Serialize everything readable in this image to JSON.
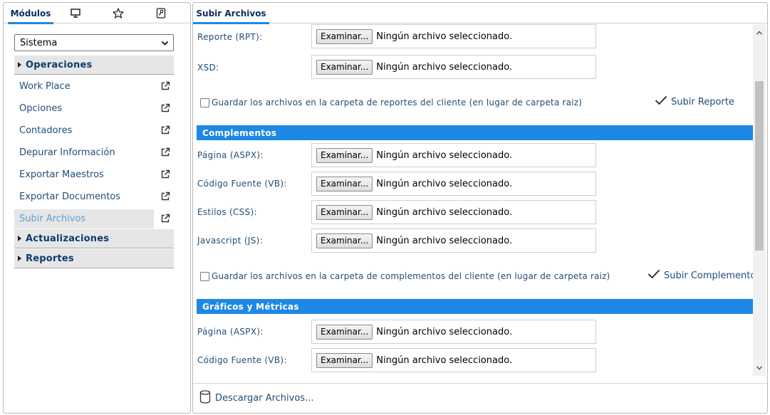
{
  "left": {
    "tabs": {
      "modules": "Módulos"
    },
    "select_value": "Sistema",
    "groups": {
      "operaciones": "Operaciones",
      "actualizaciones": "Actualizaciones",
      "reportes": "Reportes"
    },
    "items": [
      "Work Place",
      "Opciones",
      "Contadores",
      "Depurar Información",
      "Exportar Maestros",
      "Exportar Documentos",
      "Subir Archivos"
    ]
  },
  "right": {
    "tab": "Subir Archivos",
    "file_button": "Examinar...",
    "no_file": "Ningún archivo seleccionado.",
    "reporte": {
      "rpt_label": "Reporte (RPT):",
      "xsd_label": "XSD:",
      "checkbox_label": "Guardar los archivos en la carpeta de reportes del cliente (en lugar de carpeta raiz)",
      "submit": "Subir Reporte"
    },
    "complementos": {
      "title": "Complementos",
      "aspx_label": "Página (ASPX):",
      "vb_label": "Código Fuente (VB):",
      "css_label": "Estilos (CSS):",
      "js_label": "Javascript (JS):",
      "checkbox_label": "Guardar los archivos en la carpeta de complementos del cliente (en lugar de carpeta raiz)",
      "submit": "Subir Complemento"
    },
    "graficos": {
      "title": "Gráficos y Métricas",
      "aspx_label": "Página (ASPX):",
      "vb_label": "Código Fuente (VB):"
    },
    "download": "Descargar Archivos..."
  },
  "icons": {
    "tab_icons": [
      "monitor-icon",
      "star-icon",
      "wrench-icon"
    ],
    "external_link": "external-link-icon",
    "check": "check-icon",
    "database": "database-icon"
  },
  "colors": {
    "accent": "#1e88e5",
    "link_text": "#1f4e79",
    "selected_text": "#5aa0d8",
    "group_bg": "#e6e6e6"
  }
}
